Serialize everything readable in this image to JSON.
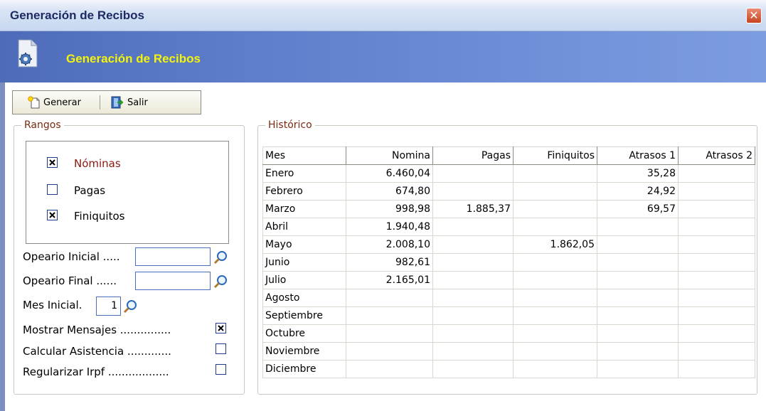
{
  "window": {
    "title": "Generación de Recibos",
    "close_glyph": "✕"
  },
  "banner": {
    "title": "Generación de Recibos",
    "icon": "document-gear-icon"
  },
  "toolbar": {
    "generar_label": "Generar",
    "generar_icon": "new-document-icon",
    "salir_label": "Salir",
    "salir_icon": "exit-door-icon"
  },
  "rangos": {
    "legend": "Rangos",
    "items": [
      {
        "label": "Nóminas",
        "checked": true
      },
      {
        "label": "Pagas",
        "checked": false
      },
      {
        "label": "Finiquitos",
        "checked": true
      }
    ]
  },
  "form": {
    "operario_inicial_label": "Opeario Inicial .....",
    "operario_inicial_value": "",
    "operario_final_label": "Opeario Final ......",
    "operario_final_value": "",
    "mes_inicial_label": "Mes Inicial.",
    "mes_inicial_value": "1",
    "search_icon": "magnifier-icon",
    "options": [
      {
        "label": "Mostrar Mensajes ...............",
        "checked": true
      },
      {
        "label": "Calcular Asistencia .............",
        "checked": false
      },
      {
        "label": "Regularizar Irpf ..................",
        "checked": false
      }
    ]
  },
  "historico": {
    "legend": "Histórico",
    "columns": [
      "Mes",
      "Nomina",
      "Pagas",
      "Finiquitos",
      "Atrasos 1",
      "Atrasos 2"
    ],
    "rows": [
      [
        "Enero",
        "6.460,04",
        "",
        "",
        "35,28",
        ""
      ],
      [
        "Febrero",
        "674,80",
        "",
        "",
        "24,92",
        ""
      ],
      [
        "Marzo",
        "998,98",
        "1.885,37",
        "",
        "69,57",
        ""
      ],
      [
        "Abril",
        "1.940,48",
        "",
        "",
        "",
        ""
      ],
      [
        "Mayo",
        "2.008,10",
        "",
        "1.862,05",
        "",
        ""
      ],
      [
        "Junio",
        "982,61",
        "",
        "",
        "",
        ""
      ],
      [
        "Julio",
        "2.165,01",
        "",
        "",
        "",
        ""
      ],
      [
        "Agosto",
        "",
        "",
        "",
        "",
        ""
      ],
      [
        "Septiembre",
        "",
        "",
        "",
        "",
        ""
      ],
      [
        "Octubre",
        "",
        "",
        "",
        "",
        ""
      ],
      [
        "Noviembre",
        "",
        "",
        "",
        "",
        ""
      ],
      [
        "Diciembre",
        "",
        "",
        "",
        "",
        ""
      ]
    ]
  },
  "colors": {
    "banner_title": "#f4f40a",
    "highlight_label": "#8b1a10",
    "legend": "#7a2a10",
    "titlebar_text": "#1d2a64"
  }
}
